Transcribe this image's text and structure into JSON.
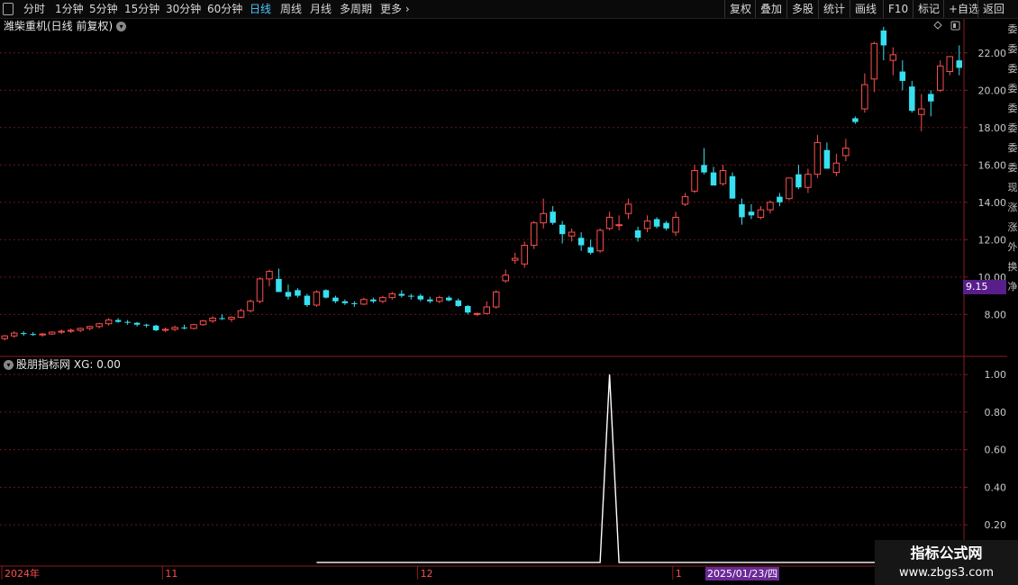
{
  "toolbar": {
    "periods": [
      "分时",
      "1分钟",
      "5分钟",
      "15分钟",
      "30分钟",
      "60分钟",
      "日线",
      "周线",
      "月线",
      "多周期",
      "更多"
    ],
    "active_period": "日线",
    "right_buttons": [
      "复权",
      "叠加",
      "多股",
      "统计",
      "画线",
      "F10",
      "标记",
      "+自选",
      "返回"
    ]
  },
  "chart_header": {
    "title": "潍柴重机(日线 前复权)"
  },
  "indicator_header": {
    "title": "股朋指标网",
    "value_label": "XG: 0.00"
  },
  "price_tag": "9.15",
  "date_tag": "2025/01/23/四",
  "right_strip_chars": [
    "委",
    "委",
    "委",
    "委",
    "委",
    "委",
    "委",
    "委",
    "现",
    "涨",
    "涨",
    "外",
    "换",
    "净"
  ],
  "watermark": {
    "line1": "指标公式网",
    "line2": "www.zbgs3.com"
  },
  "colors": {
    "up": "#ff4e4e",
    "down": "#36e0f0",
    "grid": "#6a1616",
    "axis": "#8c1c1c",
    "indicator": "#ffffff"
  },
  "chart_data": [
    {
      "type": "candlestick",
      "title": "潍柴重机(日线 前复权)",
      "yticks": [
        8.0,
        10.0,
        12.0,
        14.0,
        16.0,
        18.0,
        20.0,
        22.0
      ],
      "ylim": [
        5.8,
        23.0
      ],
      "grid": true,
      "x_labels": [
        {
          "label": "2024年",
          "index": 0
        },
        {
          "label": "11",
          "index": 17
        },
        {
          "label": "12",
          "index": 44
        },
        {
          "label": "1",
          "index": 71
        }
      ],
      "ohlc": [
        [
          6.7,
          6.9,
          6.6,
          6.85
        ],
        [
          6.85,
          7.1,
          6.75,
          7.0
        ],
        [
          7.0,
          7.1,
          6.85,
          6.95
        ],
        [
          6.95,
          7.05,
          6.85,
          6.9
        ],
        [
          6.9,
          7.0,
          6.8,
          6.95
        ],
        [
          6.95,
          7.1,
          6.9,
          7.05
        ],
        [
          7.05,
          7.2,
          6.95,
          7.1
        ],
        [
          7.1,
          7.25,
          7.0,
          7.15
        ],
        [
          7.15,
          7.3,
          7.05,
          7.25
        ],
        [
          7.25,
          7.4,
          7.15,
          7.35
        ],
        [
          7.35,
          7.55,
          7.25,
          7.5
        ],
        [
          7.5,
          7.8,
          7.4,
          7.7
        ],
        [
          7.7,
          7.8,
          7.55,
          7.6
        ],
        [
          7.6,
          7.7,
          7.45,
          7.55
        ],
        [
          7.55,
          7.6,
          7.35,
          7.45
        ],
        [
          7.45,
          7.5,
          7.3,
          7.4
        ],
        [
          7.4,
          7.45,
          7.1,
          7.15
        ],
        [
          7.15,
          7.3,
          7.05,
          7.2
        ],
        [
          7.2,
          7.4,
          7.1,
          7.3
        ],
        [
          7.3,
          7.45,
          7.2,
          7.25
        ],
        [
          7.25,
          7.5,
          7.2,
          7.45
        ],
        [
          7.45,
          7.7,
          7.4,
          7.65
        ],
        [
          7.65,
          7.9,
          7.55,
          7.8
        ],
        [
          7.8,
          8.0,
          7.7,
          7.75
        ],
        [
          7.75,
          7.9,
          7.6,
          7.85
        ],
        [
          7.85,
          8.3,
          7.8,
          8.2
        ],
        [
          8.2,
          8.8,
          8.1,
          8.7
        ],
        [
          8.7,
          10.0,
          8.6,
          9.9
        ],
        [
          9.9,
          10.4,
          9.5,
          10.3
        ],
        [
          9.9,
          10.45,
          9.2,
          9.2
        ],
        [
          9.2,
          9.6,
          8.8,
          8.95
        ],
        [
          9.3,
          9.4,
          8.9,
          9.0
        ],
        [
          9.0,
          9.1,
          8.4,
          8.5
        ],
        [
          8.5,
          9.3,
          8.4,
          9.2
        ],
        [
          9.3,
          9.35,
          8.85,
          8.9
        ],
        [
          8.9,
          9.0,
          8.6,
          8.7
        ],
        [
          8.7,
          8.8,
          8.5,
          8.6
        ],
        [
          8.6,
          8.7,
          8.4,
          8.55
        ],
        [
          8.55,
          8.9,
          8.5,
          8.8
        ],
        [
          8.8,
          8.9,
          8.6,
          8.7
        ],
        [
          8.7,
          9.0,
          8.6,
          8.9
        ],
        [
          8.9,
          9.2,
          8.8,
          9.1
        ],
        [
          9.1,
          9.3,
          8.9,
          9.0
        ],
        [
          9.0,
          9.1,
          8.8,
          8.95
        ],
        [
          9.0,
          9.1,
          8.7,
          8.8
        ],
        [
          8.8,
          8.95,
          8.6,
          8.7
        ],
        [
          8.7,
          9.0,
          8.6,
          8.9
        ],
        [
          8.9,
          9.0,
          8.7,
          8.75
        ],
        [
          8.75,
          8.85,
          8.4,
          8.45
        ],
        [
          8.45,
          8.5,
          8.0,
          8.1
        ],
        [
          8.0,
          8.1,
          7.9,
          8.05
        ],
        [
          8.05,
          8.7,
          8.0,
          8.4
        ],
        [
          8.4,
          9.3,
          8.3,
          9.2
        ],
        [
          9.8,
          10.4,
          9.7,
          10.1
        ],
        [
          10.9,
          11.3,
          10.7,
          11.0
        ],
        [
          10.7,
          11.9,
          10.5,
          11.7
        ],
        [
          11.7,
          13.0,
          11.5,
          12.9
        ],
        [
          12.9,
          14.2,
          12.6,
          13.4
        ],
        [
          13.5,
          13.8,
          12.8,
          12.9
        ],
        [
          12.8,
          13.0,
          11.8,
          12.3
        ],
        [
          12.2,
          12.6,
          11.9,
          12.4
        ],
        [
          12.1,
          12.4,
          11.4,
          11.7
        ],
        [
          11.6,
          12.0,
          11.2,
          11.3
        ],
        [
          11.4,
          12.6,
          11.3,
          12.5
        ],
        [
          12.6,
          13.5,
          12.5,
          13.2
        ],
        [
          12.8,
          13.3,
          12.5,
          12.8
        ],
        [
          13.4,
          14.2,
          13.1,
          13.9
        ],
        [
          12.5,
          12.7,
          11.9,
          12.1
        ],
        [
          12.6,
          13.3,
          12.4,
          13.0
        ],
        [
          13.1,
          13.2,
          12.6,
          12.7
        ],
        [
          12.9,
          13.0,
          12.5,
          12.6
        ],
        [
          12.4,
          13.5,
          12.2,
          13.2
        ],
        [
          13.9,
          14.5,
          13.8,
          14.3
        ],
        [
          14.6,
          16.0,
          14.5,
          15.7
        ],
        [
          16.0,
          16.9,
          15.5,
          15.6
        ],
        [
          15.6,
          15.9,
          14.9,
          14.9
        ],
        [
          15.0,
          16.0,
          14.9,
          15.7
        ],
        [
          15.4,
          15.6,
          14.2,
          14.2
        ],
        [
          13.9,
          14.2,
          12.8,
          13.2
        ],
        [
          13.5,
          13.9,
          13.1,
          13.3
        ],
        [
          13.2,
          13.8,
          13.1,
          13.6
        ],
        [
          13.6,
          14.1,
          13.4,
          14.0
        ],
        [
          14.3,
          14.5,
          13.8,
          14.0
        ],
        [
          14.2,
          15.3,
          14.1,
          15.3
        ],
        [
          15.5,
          16.0,
          14.7,
          14.8
        ],
        [
          14.8,
          15.8,
          14.5,
          15.5
        ],
        [
          15.5,
          17.6,
          15.3,
          17.2
        ],
        [
          16.8,
          17.2,
          15.8,
          15.8
        ],
        [
          15.6,
          16.6,
          15.4,
          16.1
        ],
        [
          16.5,
          17.4,
          16.2,
          16.9
        ],
        [
          18.5,
          18.6,
          18.2,
          18.3
        ],
        [
          19.0,
          20.9,
          18.8,
          20.3
        ],
        [
          20.6,
          22.6,
          19.9,
          22.5
        ],
        [
          23.2,
          23.4,
          21.6,
          22.4
        ],
        [
          21.6,
          22.3,
          20.8,
          21.9
        ],
        [
          21.0,
          21.6,
          20.0,
          20.5
        ],
        [
          20.2,
          20.5,
          18.8,
          18.9
        ],
        [
          18.7,
          19.8,
          17.8,
          19.0
        ],
        [
          19.8,
          20.0,
          18.6,
          19.4
        ],
        [
          20.0,
          21.6,
          19.9,
          21.3
        ],
        [
          21.0,
          21.8,
          20.8,
          21.8
        ],
        [
          21.6,
          22.4,
          20.8,
          21.2
        ]
      ]
    },
    {
      "type": "line",
      "series_label": "XG",
      "yticks": [
        0.2,
        0.4,
        0.6,
        0.8,
        1.0
      ],
      "ylim": [
        -0.01,
        1.02
      ],
      "start_index": 33,
      "spike_index": 64,
      "spike_value": 1.0,
      "base_value": 0.0
    }
  ]
}
